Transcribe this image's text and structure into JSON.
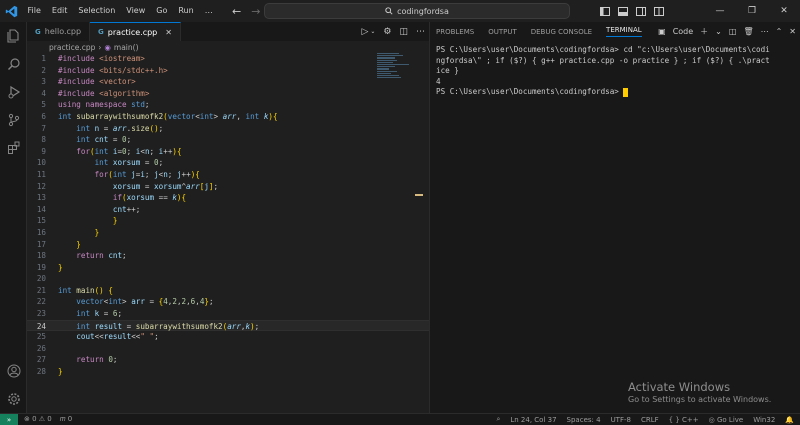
{
  "titlebar": {
    "menu": [
      "File",
      "Edit",
      "Selection",
      "View",
      "Go",
      "Run",
      "…"
    ],
    "search_text": "codingfordsa"
  },
  "tabs": [
    {
      "label": "hello.cpp",
      "active": false
    },
    {
      "label": "practice.cpp",
      "active": true
    }
  ],
  "breadcrumb": {
    "file": "practice.cpp",
    "symbol": "main()"
  },
  "code_lines": [
    "#include <iostream>",
    "#include <bits/stdc++.h>",
    "#include <vector>",
    "#include <algorithm>",
    "using namespace std;",
    "int subarraywithsumofk2(vector<int> arr, int k){",
    "    int n = arr.size();",
    "    int cnt = 0;",
    "    for(int i=0; i<n; i++){",
    "        int xorsum = 0;",
    "        for(int j=i; j<n; j++){",
    "            xorsum = xorsum^arr[j];",
    "            if(xorsum == k){",
    "            cnt++;",
    "            }",
    "        }",
    "    }",
    "    return cnt;",
    "}",
    "",
    "int main() {",
    "    vector<int> arr = {4,2,2,6,4};",
    "    int k = 6;",
    "    int result = subarraywithsumofk2(arr,k);",
    "    cout<<result<<\" \";",
    "",
    "    return 0;",
    "}"
  ],
  "current_line": 24,
  "panel": {
    "tabs": [
      "PROBLEMS",
      "OUTPUT",
      "DEBUG CONSOLE",
      "TERMINAL"
    ],
    "active_tab": "TERMINAL",
    "shell_label": "Code",
    "terminal_lines": [
      "PS C:\\Users\\user\\Documents\\codingfordsa> cd \"c:\\Users\\user\\Documents\\codi",
      "ngfordsa\\\" ; if ($?) { g++ practice.cpp -o practice } ; if ($?) { .\\pract",
      "ice }",
      "4",
      "PS C:\\Users\\user\\Documents\\codingfordsa> "
    ]
  },
  "watermark": {
    "line1": "Activate Windows",
    "line2": "Go to Settings to activate Windows."
  },
  "status": {
    "errors": "0",
    "warnings": "0",
    "ports": "0",
    "position": "Ln 24, Col 37",
    "spaces": "Spaces: 4",
    "encoding": "UTF-8",
    "eol": "CRLF",
    "language": "C++",
    "golive": "Go Live",
    "platform": "Win32"
  }
}
